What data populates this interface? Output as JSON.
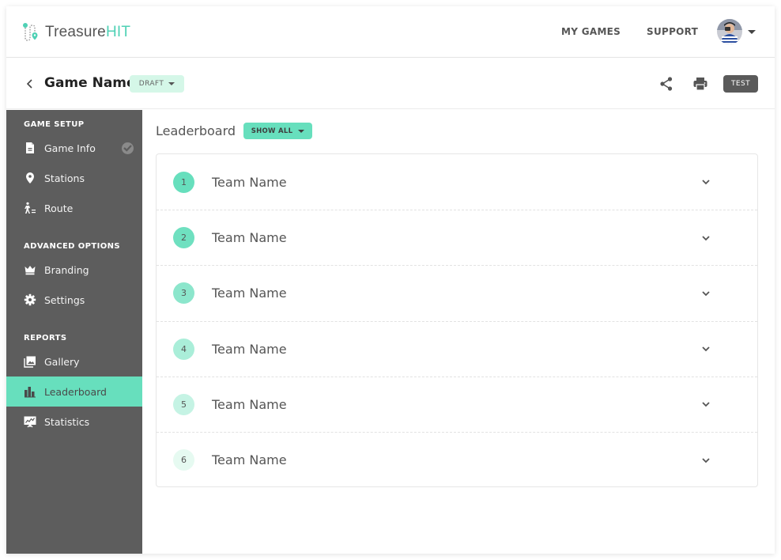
{
  "brand": {
    "name_part1": "Treasure",
    "name_part2": "HIT",
    "accent_color": "#4fd1b5"
  },
  "topnav": {
    "links": [
      "MY GAMES",
      "SUPPORT"
    ],
    "avatar_icon": "user-avatar",
    "avatar_menu_icon": "caret-down-icon"
  },
  "subheader": {
    "back_icon": "chevron-left-icon",
    "game_name": "Game Name",
    "status_badge": "DRAFT",
    "share_icon": "share-icon",
    "print_icon": "print-icon",
    "test_button": "TEST"
  },
  "sidebar": {
    "sections": [
      {
        "title": "GAME SETUP",
        "items": [
          {
            "label": "Game Info",
            "icon": "document-icon",
            "completed": true
          },
          {
            "label": "Stations",
            "icon": "map-pin-icon"
          },
          {
            "label": "Route",
            "icon": "route-walker-icon"
          }
        ]
      },
      {
        "title": "ADVANCED OPTIONS",
        "items": [
          {
            "label": "Branding",
            "icon": "crown-icon"
          },
          {
            "label": "Settings",
            "icon": "gear-icon"
          }
        ]
      },
      {
        "title": "REPORTS",
        "items": [
          {
            "label": "Gallery",
            "icon": "gallery-icon"
          },
          {
            "label": "Leaderboard",
            "icon": "bar-chart-icon",
            "active": true
          },
          {
            "label": "Statistics",
            "icon": "statistics-board-icon"
          }
        ]
      }
    ],
    "active_color": "#67dfbd",
    "background_color": "#5d5d5d"
  },
  "main": {
    "title": "Leaderboard",
    "filter_button": "SHOW ALL",
    "rows": [
      {
        "rank": "1",
        "team": "Team Name"
      },
      {
        "rank": "2",
        "team": "Team Name"
      },
      {
        "rank": "3",
        "team": "Team Name"
      },
      {
        "rank": "4",
        "team": "Team Name"
      },
      {
        "rank": "5",
        "team": "Team Name"
      },
      {
        "rank": "6",
        "team": "Team Name"
      }
    ],
    "row_expand_icon": "chevron-down-icon"
  }
}
